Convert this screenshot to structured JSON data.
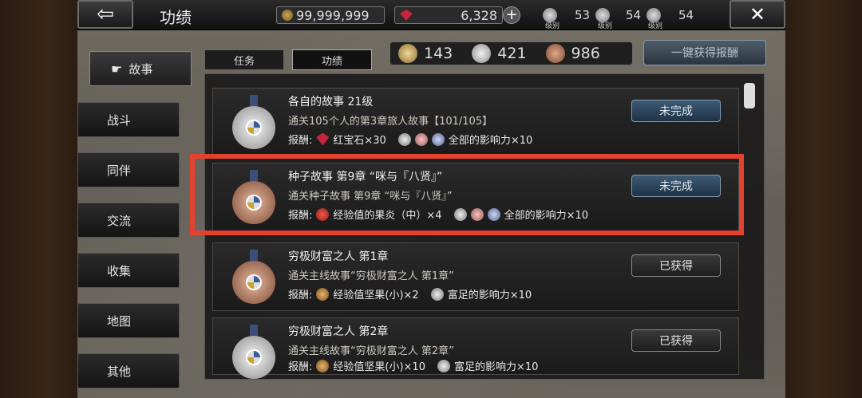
{
  "header": {
    "back_glyph": "⇦",
    "title": "功绩",
    "close_glyph": "✕",
    "gold": "99,999,999",
    "rubies": "6,328",
    "plus_glyph": "+",
    "ranks": [
      {
        "count": "53",
        "label": "级别"
      },
      {
        "count": "54",
        "label": "级别"
      },
      {
        "count": "54",
        "label": "级别"
      }
    ]
  },
  "nav": {
    "items": [
      {
        "label": "故事",
        "active": true
      },
      {
        "label": "战斗"
      },
      {
        "label": "同伴"
      },
      {
        "label": "交流"
      },
      {
        "label": "收集"
      },
      {
        "label": "地图"
      },
      {
        "label": "其他"
      }
    ]
  },
  "tabs": [
    {
      "label": "任务"
    },
    {
      "label": "功绩",
      "active": true
    }
  ],
  "medal_summary": {
    "gold": "143",
    "silver": "421",
    "bronze": "986"
  },
  "claim_all_label": "一键获得报酬",
  "achievements": [
    {
      "title": "各自的故事 21级",
      "desc": "通关105个人的第3章旅人故事【101/105】",
      "reward_label": "报酬:",
      "reward_item": "红宝石×30",
      "reward_influence": "全部的影响力×10",
      "status": "未完成",
      "medal": "silver"
    },
    {
      "title": "种子故事 第9章 “咪与『八贤』”",
      "desc": "通关种子故事 第9章 “咪与『八贤』”",
      "reward_label": "报酬:",
      "reward_item": "经验值的果炎（中）×4",
      "reward_influence": "全部的影响力×10",
      "status": "未完成",
      "medal": "bronze"
    },
    {
      "title": "穷极财富之人 第1章",
      "desc": "通关主线故事“穷极财富之人 第1章”",
      "reward_label": "报酬:",
      "reward_item": "经验值坚果(小)×2",
      "reward_influence": "富足的影响力×10",
      "status": "已获得",
      "medal": "bronze"
    },
    {
      "title": "穷极财富之人 第2章",
      "desc": "通关主线故事“穷极财富之人 第2章”",
      "reward_label": "报酬:",
      "reward_item": "经验值坚果(小)×10",
      "reward_influence": "富足的影响力×10",
      "status": "已获得",
      "medal": "silver"
    }
  ],
  "colors": {
    "highlight": "#e4412f",
    "incomplete_button": "#3d5a74"
  }
}
